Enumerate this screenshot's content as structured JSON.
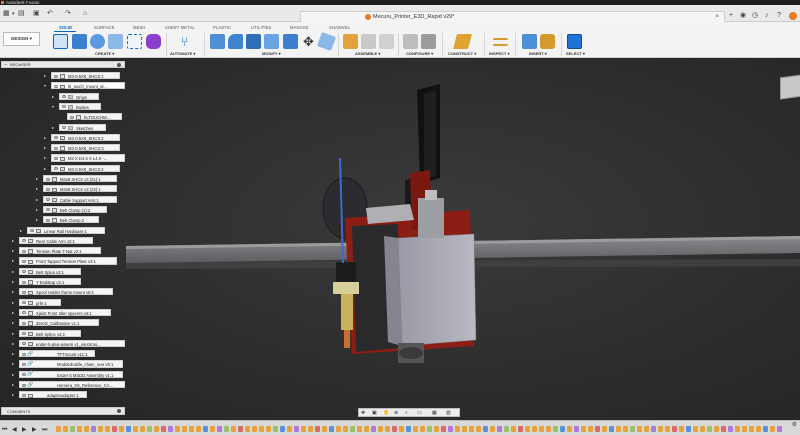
{
  "app": {
    "title": "Autodesk Fusion"
  },
  "document": {
    "title": "Mecuru_Printer_E3D_Rapid v29*"
  },
  "workspace": {
    "label": "DESIGN ▾"
  },
  "ribbon": {
    "tabs": [
      "SOLID",
      "SURFACE",
      "MESH",
      "SHEET METAL",
      "PLASTIC",
      "UTILITIES",
      "MANAGE",
      "SHAWVEL"
    ],
    "active_tab": "SOLID",
    "groups": [
      "CREATE ▾",
      "AUTOMATE ▾",
      "MODIFY ▾",
      "ASSEMBLE ▾",
      "CONFIGURE ▾",
      "CONSTRUCT ▾",
      "INSPECT ▾",
      "INSERT ▾",
      "SELECT ▾"
    ]
  },
  "browser": {
    "title": "BROWSER",
    "items": [
      {
        "label": "M3-0.5X8_SHCS:1"
      },
      {
        "label": "bl_touch_mount_al..."
      },
      {
        "label": "Origin"
      },
      {
        "label": "Bodies"
      },
      {
        "label": "bLTOUCHM..."
      },
      {
        "label": "Sketches"
      },
      {
        "label": "M3-0.5X8_SHCS:2"
      },
      {
        "label": "M3-0.5X8_SHCS:3"
      },
      {
        "label": "M3 X D4.5 X L4.0 -..."
      },
      {
        "label": "M3-0.5X8_SHCS:4"
      },
      {
        "label": "M3x8 SHCS v3 (21):1"
      },
      {
        "label": "M3x8 SHCS v3 (22):1"
      },
      {
        "label": "Cable Support Arm:1"
      },
      {
        "label": "Belt Clamp (1):2"
      },
      {
        "label": "Belt Clamp:2"
      },
      {
        "label": "Linear Rail Hardware:1"
      },
      {
        "label": "Rear Cable Arm v2:1"
      },
      {
        "label": "Tension Plate T-Nut v2:1"
      },
      {
        "label": "Front Tapped Tension Plate v3:1"
      },
      {
        "label": "Belt Splus v3:1"
      },
      {
        "label": "Y Endstop v2:1"
      },
      {
        "label": "Spool Holder frame mount v8:1"
      },
      {
        "label": "prfe:1"
      },
      {
        "label": "Xjoint Front Idler spacers v4:1"
      },
      {
        "label": "ZeroG_Calibration v1:1"
      },
      {
        "label": "Belt Splice v3:2"
      },
      {
        "label": "ender-5-plus-assem v1_electroni..."
      },
      {
        "label": "TFTmount v11:1"
      },
      {
        "label": "Moddedcable_chain_rear v5:1"
      },
      {
        "label": "Ender 5 MSDD Assembly v1:1"
      },
      {
        "label": "Hemera_XS_Reference_CA..."
      },
      {
        "label": "adapteradapter:1"
      }
    ]
  },
  "comments": {
    "title": "COMMENTS"
  },
  "colors": {
    "accent": "#0b64c0",
    "viewport_bg": "#333333",
    "carriage_red": "#8c1d14",
    "block_gray": "#a9a9b5",
    "rail": "#6f6f72"
  }
}
